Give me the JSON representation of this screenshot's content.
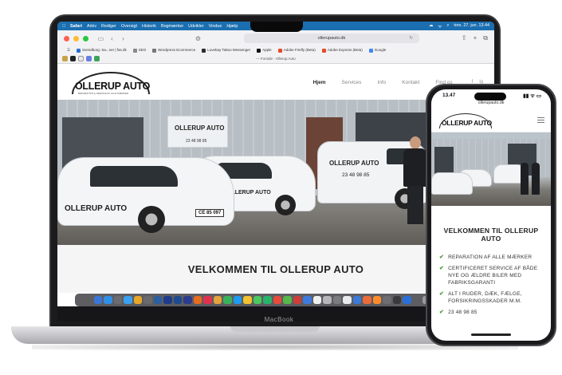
{
  "macbook": {
    "label": "MacBook",
    "menubar": {
      "apple": "",
      "items": [
        "Safari",
        "Arkiv",
        "Rediger",
        "Oversigt",
        "Historik",
        "Bogmærker",
        "Udvikler",
        "Vindue",
        "Hjælp"
      ],
      "clock": "tors. 27. jun.  13.44"
    },
    "browser": {
      "url": "ollerupauto.dk",
      "bookmarks": [
        "Svendborg: Sa...ner | fas.dk",
        "SEO",
        "Wordpress Ecommerce",
        "Lovebay Tattoo Messenger",
        "Apple",
        "Adobe Firefly (Beta)",
        "Adobe Express (Beta)",
        "Google"
      ],
      "tab_title": "Forside - Ollerup Auto"
    },
    "site": {
      "logo": "OLLERUP AUTO",
      "logo_sub": "REPARATION & SERVICE AF ALLE MÆRKER",
      "nav": [
        "Hjem",
        "Services",
        "Info",
        "Kontakt",
        "Find os"
      ],
      "social": [
        "f",
        "ig"
      ],
      "hero": {
        "sign_logo": "OLLERUP AUTO",
        "sign_phone": "23 48 98 85",
        "van_phone": "23 48 98 85",
        "car_logo": "OLLERUP AUTO",
        "plate": "CE 85 097"
      },
      "welcome_title": "VELKOMMEN TIL OLLERUP AUTO"
    },
    "dock_colors": [
      "#3a76d8",
      "#2f8ee8",
      "#6c6c70",
      "#3aa0f0",
      "#e8a628",
      "#6a6a6e",
      "#2b5f9e",
      "#1f3c8c",
      "#1e4a8e",
      "#2d3b8c",
      "#e66c1f",
      "#e0314f",
      "#e6a23c",
      "#3ab25a",
      "#1d9bf0",
      "#f2c230",
      "#4ac95e",
      "#29b26a",
      "#e94a3c",
      "#56b74a",
      "#cf3d3a",
      "#3d7ae0",
      "#f0f0f0",
      "#b7b7bb",
      "#7b7b80",
      "#e9eaee",
      "#3b7ad9",
      "#ec6b3b",
      "#ff8c2c",
      "#6d6d72",
      "#3a3a3e",
      "#2a6fd8",
      "#5e5e62",
      "#9a9aa0"
    ]
  },
  "iphone": {
    "time": "13.47",
    "status_icons": "▮▮ ᯤ ▭",
    "url": "ollerupauto.dk",
    "logo": "OLLERUP AUTO",
    "title": "VELKOMMEN TIL OLLERUP AUTO",
    "list": [
      "REPARATION AF ALLE MÆRKER",
      "CERTIFICERET SERVICE AF BÅDE NYE OG ÆLDRE BILER MED FABRIKSGARANTI",
      "ALT I RUDER, DÆK, FÆLGE, FORSIKRINGSSKADER M.M.",
      "23 48 98 85"
    ],
    "check_color": "#4b9b3a"
  }
}
